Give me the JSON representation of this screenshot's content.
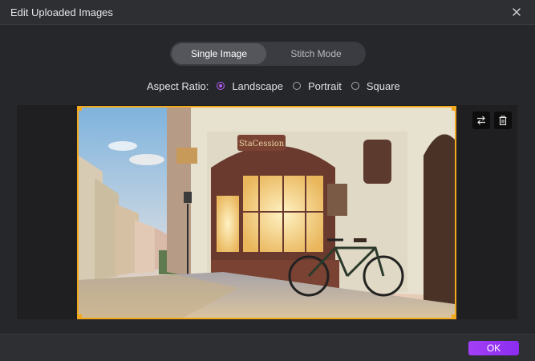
{
  "window": {
    "title": "Edit Uploaded Images",
    "close_icon": "close-icon"
  },
  "mode_toggle": {
    "options": [
      {
        "label": "Single Image",
        "active": true
      },
      {
        "label": "Stitch Mode",
        "active": false
      }
    ]
  },
  "aspect_ratio": {
    "label": "Aspect Ratio:",
    "options": [
      {
        "label": "Landscape",
        "checked": true
      },
      {
        "label": "Portrait",
        "checked": false
      },
      {
        "label": "Square",
        "checked": false
      }
    ]
  },
  "image": {
    "sign_text": "StaCession"
  },
  "tools": {
    "replace_icon": "swap-arrows-icon",
    "delete_icon": "trash-icon"
  },
  "footer": {
    "ok_label": "OK"
  },
  "colors": {
    "accent": "#b45ffa",
    "frame": "#f2a81c",
    "ok_gradient_start": "#a33ff5",
    "ok_gradient_end": "#8b2cf0"
  }
}
